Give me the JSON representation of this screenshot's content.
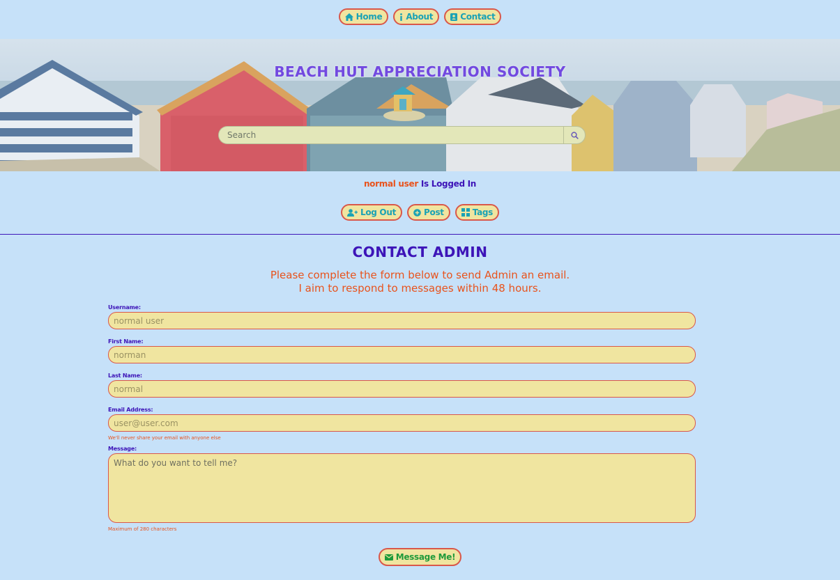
{
  "topnav": {
    "items": [
      {
        "label": "Home",
        "icon": "home-icon"
      },
      {
        "label": "About",
        "icon": "info-icon"
      },
      {
        "label": "Contact",
        "icon": "contact-card-icon"
      }
    ]
  },
  "hero": {
    "title": "BEACH HUT APPRECIATION SOCIETY",
    "search_placeholder": "Search",
    "search_icon": "search-icon"
  },
  "status": {
    "username": "normal user",
    "suffix": "Is Logged In"
  },
  "usernav": {
    "items": [
      {
        "label": "Log Out",
        "icon": "user-plus-icon"
      },
      {
        "label": "Post",
        "icon": "plus-circle-icon"
      },
      {
        "label": "Tags",
        "icon": "tags-icon"
      }
    ]
  },
  "page": {
    "heading": "CONTACT ADMIN",
    "intro_line1": "Please complete the form below to send Admin an email.",
    "intro_line2": "I aim to respond to messages within 48 hours."
  },
  "form": {
    "username_label": "Username:",
    "username_value": "normal user",
    "first_name_label": "First Name:",
    "first_name_value": "norman",
    "last_name_label": "Last Name:",
    "last_name_value": "normal",
    "email_label": "Email Address:",
    "email_value": "user@user.com",
    "email_help": "We'll never share your email with anyone else",
    "message_label": "Message:",
    "message_placeholder": "What do you want to tell me?",
    "message_help": "Maximum of 280 characters",
    "submit_label": "Message Me!",
    "submit_icon": "envelope-icon"
  },
  "colors": {
    "background": "#c6e1f9",
    "accent_purple": "#3d14b8",
    "accent_orange": "#e8531d",
    "field_fill": "#f0e5a0",
    "field_border": "#d9574a",
    "nav_text": "#1aa2b5",
    "submit_text": "#1f9a3a"
  }
}
